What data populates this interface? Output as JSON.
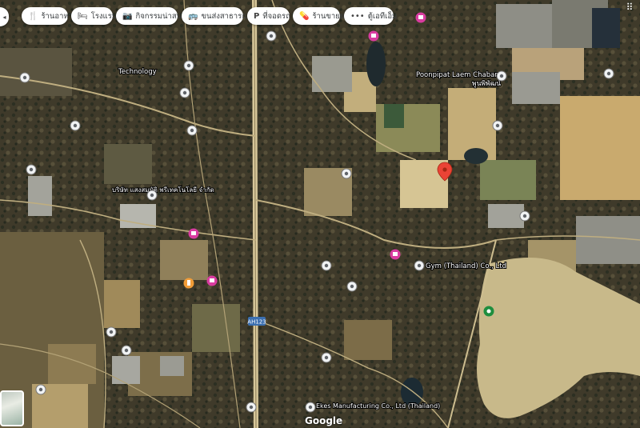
{
  "chips": [
    {
      "icon": "fork-knife-icon",
      "label": "ร้านอาหาร"
    },
    {
      "icon": "bed-icon",
      "label": "โรงแรม"
    },
    {
      "icon": "camera-icon",
      "label": "กิจกรรมน่าสนใจ"
    },
    {
      "icon": "bus-icon",
      "label": "ขนส่งสาธารณะ"
    },
    {
      "icon": "parking-icon",
      "label": "ที่จอดรถ"
    },
    {
      "icon": "pill-icon",
      "label": "ร้านขายยา"
    },
    {
      "icon": "more-icon",
      "label": "ตู้เอทีเอ็ม"
    }
  ],
  "places": [
    {
      "label": "Poonpipat Laem Chabang"
    },
    {
      "label": "พูนพิพัฒน์"
    },
    {
      "label": "Technology"
    },
    {
      "label": "Gym (Thailand) Co., Ltd"
    },
    {
      "label": "บริษัท แสงสมบัติ พรีเทคโนโลยี จำกัด"
    },
    {
      "label": "AH123"
    },
    {
      "label": "Ekes Manufacturing Co., Ltd (Thailand)"
    },
    {
      "label": "Google"
    }
  ],
  "colors": {
    "pin": "#ea4335",
    "poi": "#d93ca0",
    "water": "#c8b98a",
    "road": "#c9b98e"
  }
}
